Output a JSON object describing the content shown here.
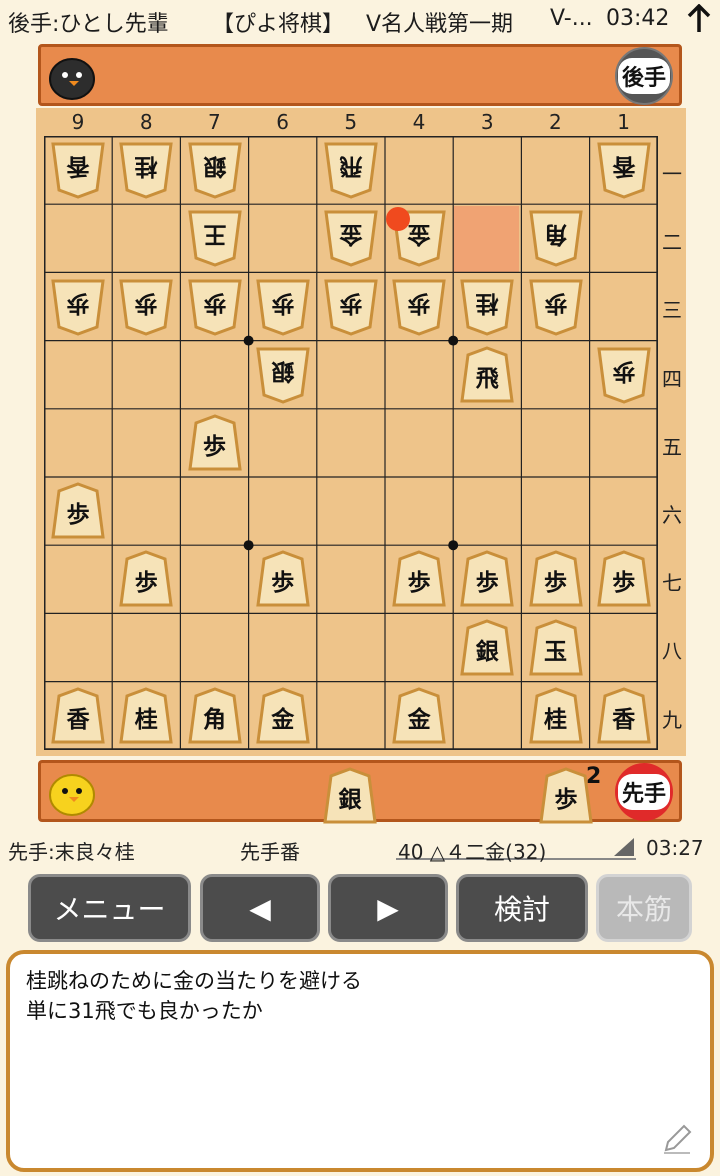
{
  "status_bar": {
    "gote_player": "後手:ひとし先輩",
    "app_title": "【ぴよ将棋】",
    "event": "V名人戦第一期",
    "extra": "V-...",
    "clock": "03:42"
  },
  "gote": {
    "badge": "後手"
  },
  "sente": {
    "badge": "先手",
    "hand": [
      {
        "piece": "銀",
        "count": ""
      },
      {
        "piece": "歩",
        "count": "2"
      }
    ]
  },
  "board": {
    "col_labels": [
      "9",
      "8",
      "7",
      "6",
      "5",
      "4",
      "3",
      "2",
      "1"
    ],
    "row_labels": [
      "一",
      "二",
      "三",
      "四",
      "五",
      "六",
      "七",
      "八",
      "九"
    ],
    "last_move_square": "32",
    "pieces": [
      {
        "sq": "91",
        "p": "香",
        "side": "gote"
      },
      {
        "sq": "81",
        "p": "桂",
        "side": "gote"
      },
      {
        "sq": "71",
        "p": "銀",
        "side": "gote"
      },
      {
        "sq": "51",
        "p": "飛",
        "side": "gote"
      },
      {
        "sq": "11",
        "p": "香",
        "side": "gote"
      },
      {
        "sq": "72",
        "p": "王",
        "side": "gote"
      },
      {
        "sq": "52",
        "p": "金",
        "side": "gote"
      },
      {
        "sq": "42",
        "p": "金",
        "side": "gote"
      },
      {
        "sq": "22",
        "p": "角",
        "side": "gote"
      },
      {
        "sq": "93",
        "p": "歩",
        "side": "gote"
      },
      {
        "sq": "83",
        "p": "歩",
        "side": "gote"
      },
      {
        "sq": "73",
        "p": "歩",
        "side": "gote"
      },
      {
        "sq": "63",
        "p": "歩",
        "side": "gote"
      },
      {
        "sq": "53",
        "p": "歩",
        "side": "gote"
      },
      {
        "sq": "43",
        "p": "歩",
        "side": "gote"
      },
      {
        "sq": "33",
        "p": "桂",
        "side": "gote"
      },
      {
        "sq": "23",
        "p": "歩",
        "side": "gote"
      },
      {
        "sq": "64",
        "p": "銀",
        "side": "gote"
      },
      {
        "sq": "14",
        "p": "歩",
        "side": "gote"
      },
      {
        "sq": "34",
        "p": "飛",
        "side": "sente"
      },
      {
        "sq": "75",
        "p": "歩",
        "side": "sente"
      },
      {
        "sq": "96",
        "p": "歩",
        "side": "sente"
      },
      {
        "sq": "87",
        "p": "歩",
        "side": "sente"
      },
      {
        "sq": "67",
        "p": "歩",
        "side": "sente"
      },
      {
        "sq": "47",
        "p": "歩",
        "side": "sente"
      },
      {
        "sq": "37",
        "p": "歩",
        "side": "sente"
      },
      {
        "sq": "27",
        "p": "歩",
        "side": "sente"
      },
      {
        "sq": "17",
        "p": "歩",
        "side": "sente"
      },
      {
        "sq": "38",
        "p": "銀",
        "side": "sente"
      },
      {
        "sq": "28",
        "p": "玉",
        "side": "sente"
      },
      {
        "sq": "99",
        "p": "香",
        "side": "sente"
      },
      {
        "sq": "89",
        "p": "桂",
        "side": "sente"
      },
      {
        "sq": "79",
        "p": "角",
        "side": "sente"
      },
      {
        "sq": "69",
        "p": "金",
        "side": "sente"
      },
      {
        "sq": "49",
        "p": "金",
        "side": "sente"
      },
      {
        "sq": "29",
        "p": "桂",
        "side": "sente"
      },
      {
        "sq": "19",
        "p": "香",
        "side": "sente"
      }
    ]
  },
  "info": {
    "sente_player": "先手:末良々桂",
    "turn": "先手番",
    "move": "40 △４二金(32)",
    "time": "03:27"
  },
  "buttons": {
    "menu": "メニュー",
    "prev": "◀",
    "next": "▶",
    "analyze": "検討",
    "mainline": "本筋"
  },
  "comment": {
    "line1": "桂跳ねのために金の当たりを避ける",
    "line2": "単に31飛でも良かったか"
  },
  "colors": {
    "accent_orange": "#e88a4c",
    "board": "#eec48a",
    "highlight": "#f0a070",
    "last_move_dot": "#f04a1e"
  }
}
